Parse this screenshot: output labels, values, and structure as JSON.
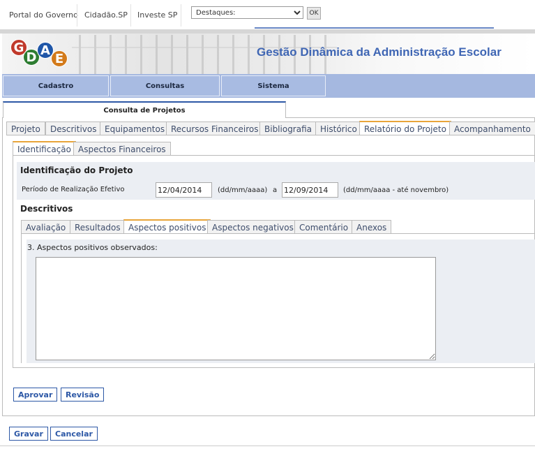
{
  "top_bar": {
    "links": [
      "Portal do Governo",
      "Cidadão.SP",
      "Investe SP"
    ],
    "select_value": "Destaques:",
    "ok_label": "OK"
  },
  "banner": {
    "logo_letters": [
      "G",
      "D",
      "A",
      "E"
    ],
    "title": "Gestão Dinâmica da Administração Escolar"
  },
  "menu": {
    "items": [
      "Cadastro",
      "Consultas",
      "Sistema"
    ]
  },
  "main_tab": "Consulta de Projetos",
  "project_tabs": {
    "items": [
      "Projeto",
      "Descritivos",
      "Equipamentos",
      "Recursos Financeiros",
      "Bibliografia",
      "Histórico",
      "Relatório do Projeto",
      "Acompanhamento"
    ],
    "active": "Relatório do Projeto"
  },
  "report_tabs": {
    "items": [
      "Identificação",
      "Aspectos Financeiros"
    ],
    "active": "Identificação"
  },
  "identification": {
    "title": "Identificação do Projeto",
    "period_label": "Período de Realização Efetivo",
    "start_date": "12/04/2014",
    "start_hint": "(dd/mm/aaaa)",
    "connector": "a",
    "end_date": "12/09/2014",
    "end_hint": "(dd/mm/aaaa - até novembro)"
  },
  "descritivos": {
    "title": "Descritivos",
    "tabs": [
      "Avaliação",
      "Resultados",
      "Aspectos positivos",
      "Aspectos negativos",
      "Comentário",
      "Anexos"
    ],
    "active": "Aspectos positivos",
    "field_label": "3. Aspectos positivos observados:",
    "field_value": ""
  },
  "actions": {
    "approve": "Aprovar",
    "revision": "Revisão",
    "save": "Gravar",
    "cancel": "Cancelar"
  },
  "colors": {
    "accent": "#2d58a6",
    "menu_bg": "#a5b8e0",
    "active_tab_top": "#e8a53a",
    "title_blue": "#3f66b4"
  }
}
